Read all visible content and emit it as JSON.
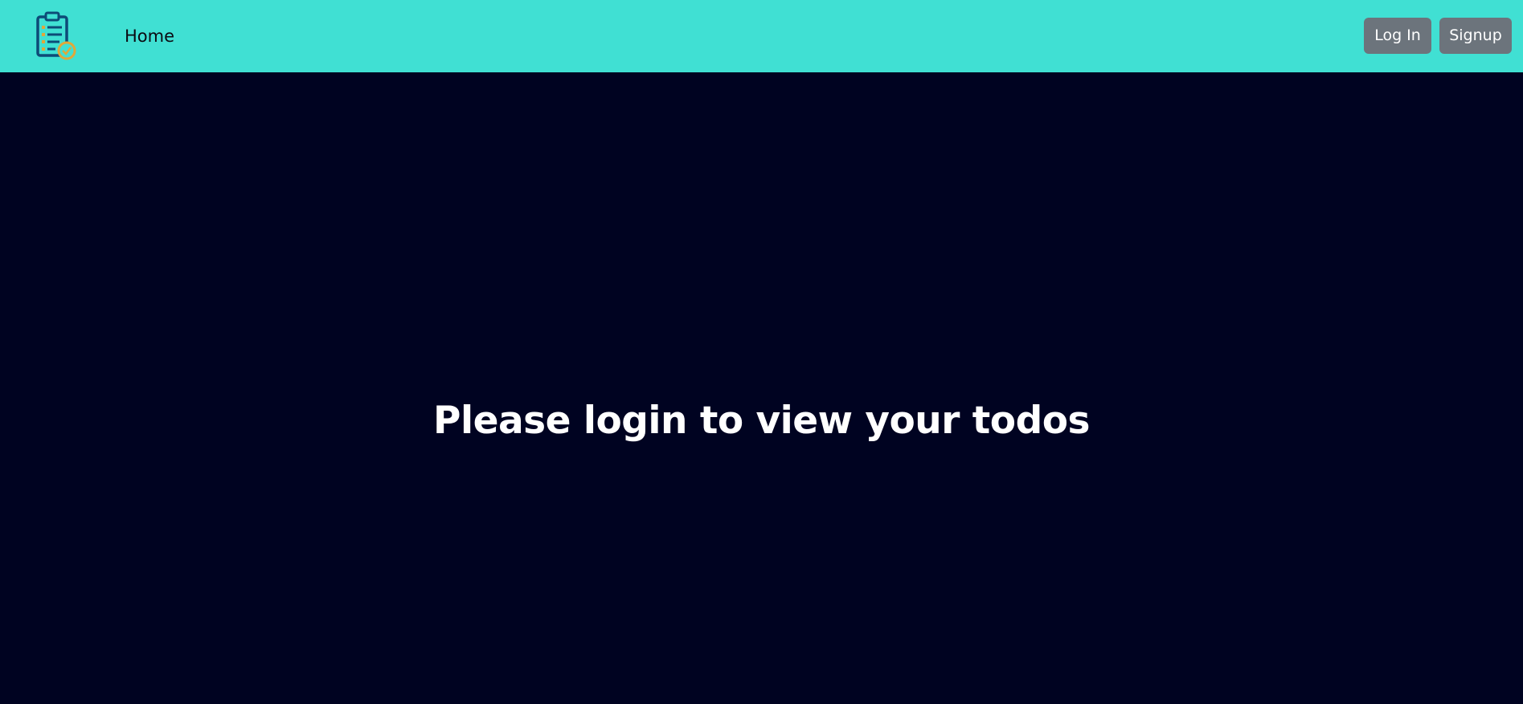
{
  "navbar": {
    "logo_icon": "clipboard-checklist-icon",
    "home_label": "Home",
    "login_label": "Log In",
    "signup_label": "Signup",
    "background": "#40e0d3",
    "button_color": "#6c747c"
  },
  "main": {
    "message": "Please login to view your todos",
    "background": "#000321"
  }
}
